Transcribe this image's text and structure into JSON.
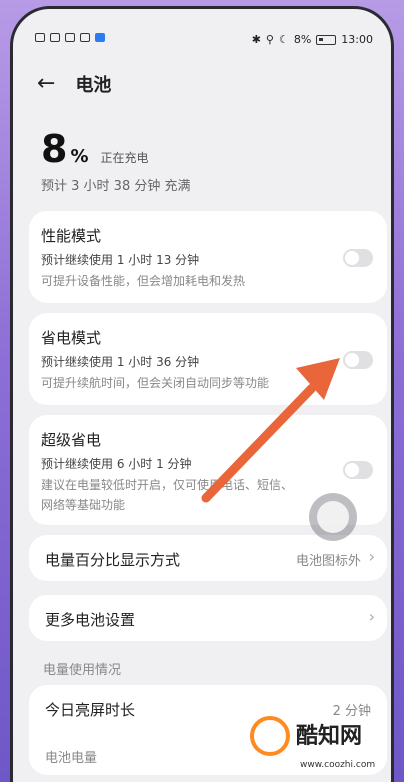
{
  "status_bar": {
    "time": "13:00",
    "battery_text": "8%"
  },
  "header": {
    "title": "电池"
  },
  "battery": {
    "level": "8",
    "unit": "%",
    "charging_label": "正在充电",
    "estimate": "预计 3 小时 38 分钟 充满"
  },
  "modes": [
    {
      "name": "性能模式",
      "usage": "预计继续使用 1 小时 13 分钟",
      "desc": "可提升设备性能，但会增加耗电和发热",
      "enabled": false
    },
    {
      "name": "省电模式",
      "usage": "预计继续使用 1 小时 36 分钟",
      "desc": "可提升续航时间，但会关闭自动同步等功能",
      "enabled": false
    },
    {
      "name": "超级省电",
      "usage": "预计继续使用 6 小时 1 分钟",
      "desc_line1": "建议在电量较低时开启，仅可使用电话、短信、",
      "desc_line2": "网络等基础功能",
      "enabled": false
    }
  ],
  "display_mode": {
    "label": "电量百分比显示方式",
    "value": "电池图标外"
  },
  "more_settings": {
    "label": "更多电池设置"
  },
  "usage_section": {
    "label": "电量使用情况"
  },
  "screen_time": {
    "label": "今日亮屏时长",
    "value": "2 分钟"
  },
  "battery_level_section": {
    "label": "电池电量"
  },
  "watermark": {
    "name": "酷知网",
    "url": "www.coozhi.com"
  },
  "colors": {
    "arrow": "#e8663a",
    "accent": "#ff8a1f"
  }
}
